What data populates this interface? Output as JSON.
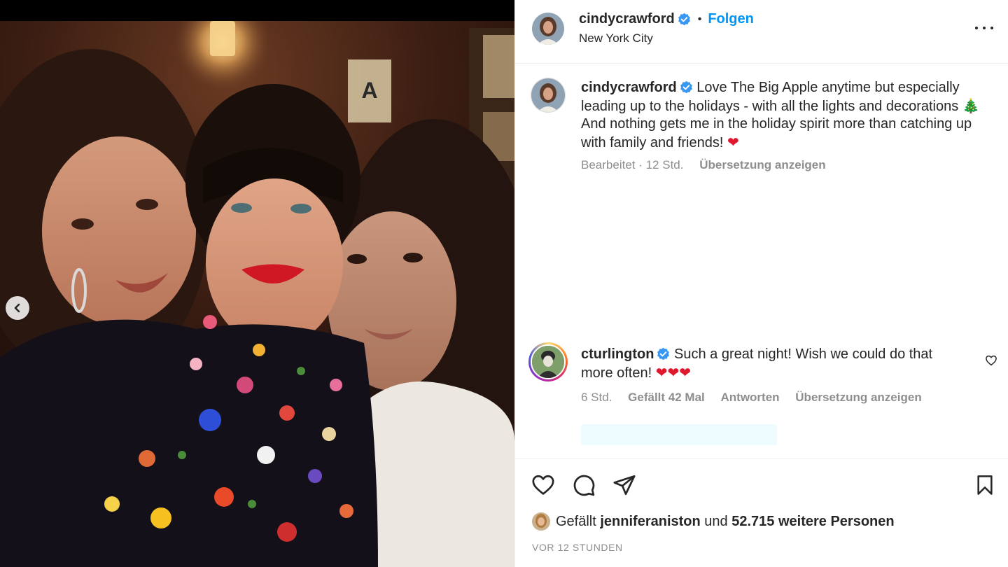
{
  "post": {
    "author": "cindycrawford",
    "follow_label": "Folgen",
    "dot": "•",
    "location": "New York City",
    "caption_text_1": "Love The Big Apple anytime but especially leading up to the holidays - with all the lights and decorations ",
    "caption_tree": "🎄",
    "caption_text_2": " And nothing gets me in the holiday spirit more than catching up with family and friends! ",
    "caption_heart": "❤",
    "caption_meta": "Bearbeitet · 12 Std.",
    "caption_translate": "Übersetzung anzeigen"
  },
  "comment": {
    "author": "cturlington",
    "text": "Such a great night! Wish we could do that more often! ",
    "hearts": "❤❤❤",
    "time": "6 Std.",
    "likes": "Gefällt 42 Mal",
    "reply": "Antworten",
    "translate": "Übersetzung anzeigen"
  },
  "likes": {
    "prefix": "Gefällt",
    "user": "jenniferaniston",
    "middle": "und",
    "others": "52.715 weitere Personen"
  },
  "timestamp": "VOR 12 STUNDEN",
  "icons": {
    "verified": "verified-badge-icon",
    "more": "more-options-icon",
    "like": "heart-icon",
    "comment": "comment-icon",
    "share": "send-icon",
    "save": "bookmark-icon",
    "prev": "chevron-left-icon"
  },
  "colors": {
    "link": "#0095f6",
    "verified": "#3897f0",
    "text": "#262626",
    "muted": "#8e8e8e"
  }
}
